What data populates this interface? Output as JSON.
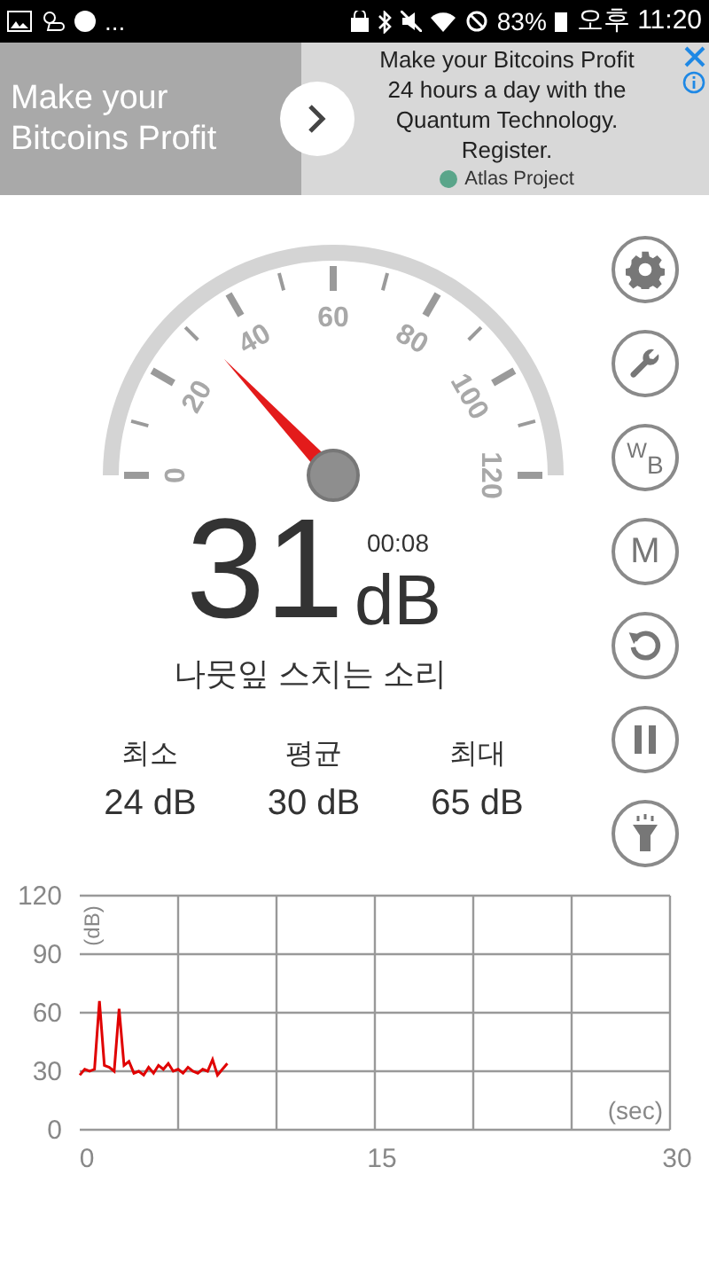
{
  "status_bar": {
    "notification_overflow": "...",
    "battery": "83%",
    "time": "오후 11:20"
  },
  "ad": {
    "headline": "Make your Bitcoins Profit",
    "body": "Make your Bitcoins Profit 24 hours a day with the Quantum Technology. Register.",
    "advertiser": "Atlas Project"
  },
  "gauge": {
    "scale": [
      "0",
      "20",
      "40",
      "60",
      "80",
      "100",
      "120"
    ]
  },
  "reading": {
    "value": "31",
    "unit": "dB",
    "elapsed": "00:08",
    "description": "나뭇잎 스치는 소리"
  },
  "stats": [
    {
      "label": "최소",
      "value": "24 dB"
    },
    {
      "label": "평균",
      "value": "30 dB"
    },
    {
      "label": "최대",
      "value": "65 dB"
    }
  ],
  "side_buttons": [
    {
      "kind": "gear"
    },
    {
      "kind": "wrench"
    },
    {
      "kind": "wb",
      "label": "W",
      "sub": "B"
    },
    {
      "kind": "text",
      "label": "M"
    },
    {
      "kind": "reset"
    },
    {
      "kind": "pause"
    },
    {
      "kind": "light"
    }
  ],
  "history": {
    "chart_data": {
      "type": "line",
      "grid": true,
      "xlabel": "(sec)",
      "ylabel": "(dB)",
      "xlim": [
        0,
        30
      ],
      "ylim": [
        0,
        120
      ],
      "xticks": [
        0,
        15,
        30
      ],
      "yticks": [
        0,
        30,
        60,
        90,
        120
      ],
      "x": [
        0,
        0.25,
        0.5,
        0.75,
        1,
        1.25,
        1.5,
        1.75,
        2,
        2.25,
        2.5,
        2.75,
        3,
        3.25,
        3.5,
        3.75,
        4,
        4.25,
        4.5,
        4.75,
        5,
        5.25,
        5.5,
        5.75,
        6,
        6.25,
        6.5,
        6.75,
        7,
        7.25,
        7.5
      ],
      "series": [
        {
          "color": "#e00000",
          "values": [
            28,
            31,
            30,
            31,
            66,
            33,
            32,
            30,
            62,
            33,
            35,
            29,
            30,
            28,
            32,
            29,
            33,
            31,
            34,
            30,
            31,
            29,
            32,
            30,
            29,
            31,
            30,
            36,
            28,
            31,
            34
          ]
        }
      ]
    }
  }
}
